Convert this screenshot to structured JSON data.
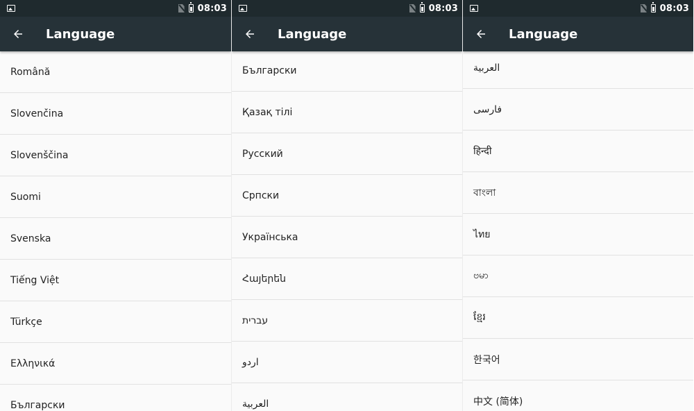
{
  "status": {
    "time": "08:03"
  },
  "app": {
    "title": "Language"
  },
  "panels": [
    {
      "items": [
        "Română",
        "Slovenčina",
        "Slovenščina",
        "Suomi",
        "Svenska",
        "Tiếng Việt",
        "Türkçe",
        "Ελληνικά",
        "Български"
      ]
    },
    {
      "items": [
        "Български",
        "Қазақ тілі",
        "Русский",
        "Српски",
        "Українська",
        "Հայերեն",
        "עברית",
        "اردو",
        "العربية"
      ]
    },
    {
      "items": [
        "العربية",
        "فارسی",
        "हिन्दी",
        "বাংলা",
        "ไทย",
        "ဗမာ",
        "ខ្មែរ",
        "한국어",
        "中文 (简体)"
      ]
    }
  ]
}
